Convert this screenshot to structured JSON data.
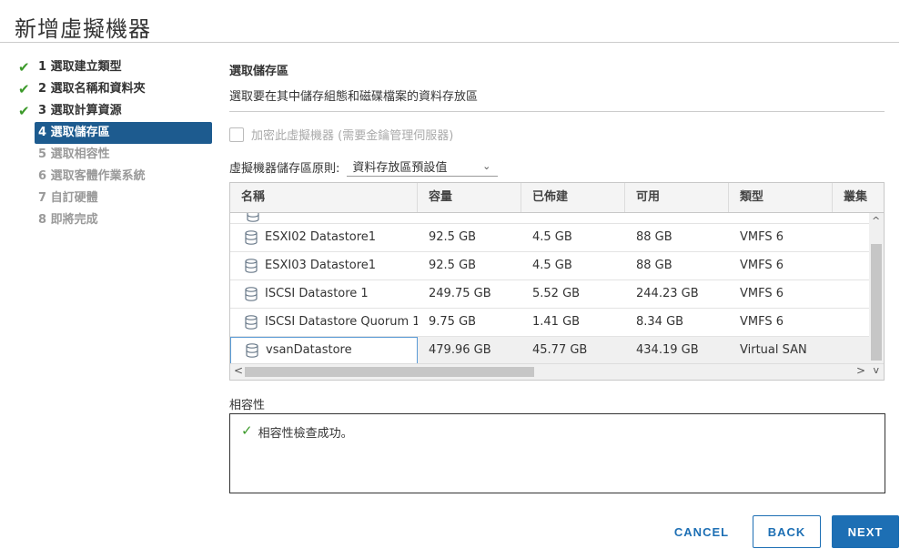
{
  "window": {
    "title": "新增虛擬機器"
  },
  "steps": [
    {
      "label": "1 選取建立類型",
      "state": "done"
    },
    {
      "label": "2 選取名稱和資料夾",
      "state": "done"
    },
    {
      "label": "3 選取計算資源",
      "state": "done"
    },
    {
      "label": "4 選取儲存區",
      "state": "active"
    },
    {
      "label": "5 選取相容性",
      "state": "pending"
    },
    {
      "label": "6 選取客體作業系統",
      "state": "pending"
    },
    {
      "label": "7 自訂硬體",
      "state": "pending"
    },
    {
      "label": "8 即將完成",
      "state": "pending"
    }
  ],
  "section": {
    "title": "選取儲存區",
    "subtitle": "選取要在其中儲存組態和磁碟檔案的資料存放區"
  },
  "encrypt": {
    "label": "加密此虛擬機器 (需要金鑰管理伺服器)",
    "checked": false
  },
  "policy": {
    "label": "虛擬機器儲存區原則:",
    "value": "資料存放區預設值"
  },
  "table": {
    "columns": [
      "名稱",
      "容量",
      "已佈建",
      "可用",
      "類型",
      "叢集"
    ],
    "rows": [
      {
        "name": "ESXI02 Datastore1",
        "capacity": "92.5 GB",
        "provisioned": "4.5 GB",
        "free": "88 GB",
        "type": "VMFS 6"
      },
      {
        "name": "ESXI03 Datastore1",
        "capacity": "92.5 GB",
        "provisioned": "4.5 GB",
        "free": "88 GB",
        "type": "VMFS 6"
      },
      {
        "name": "ISCSI Datastore 1",
        "capacity": "249.75 GB",
        "provisioned": "5.52 GB",
        "free": "244.23 GB",
        "type": "VMFS 6"
      },
      {
        "name": "ISCSI Datastore Quorum 1",
        "capacity": "9.75 GB",
        "provisioned": "1.41 GB",
        "free": "8.34 GB",
        "type": "VMFS 6"
      },
      {
        "name": "vsanDatastore",
        "capacity": "479.96 GB",
        "provisioned": "45.77 GB",
        "free": "434.19 GB",
        "type": "Virtual SAN",
        "selected": true
      }
    ]
  },
  "compatibility": {
    "label": "相容性",
    "message": "相容性檢查成功。"
  },
  "buttons": {
    "cancel": "CANCEL",
    "back": "BACK",
    "next": "NEXT"
  },
  "colors": {
    "accent": "#1d6fb4",
    "active_step": "#1d5b8f",
    "success": "#3c9a2a"
  }
}
